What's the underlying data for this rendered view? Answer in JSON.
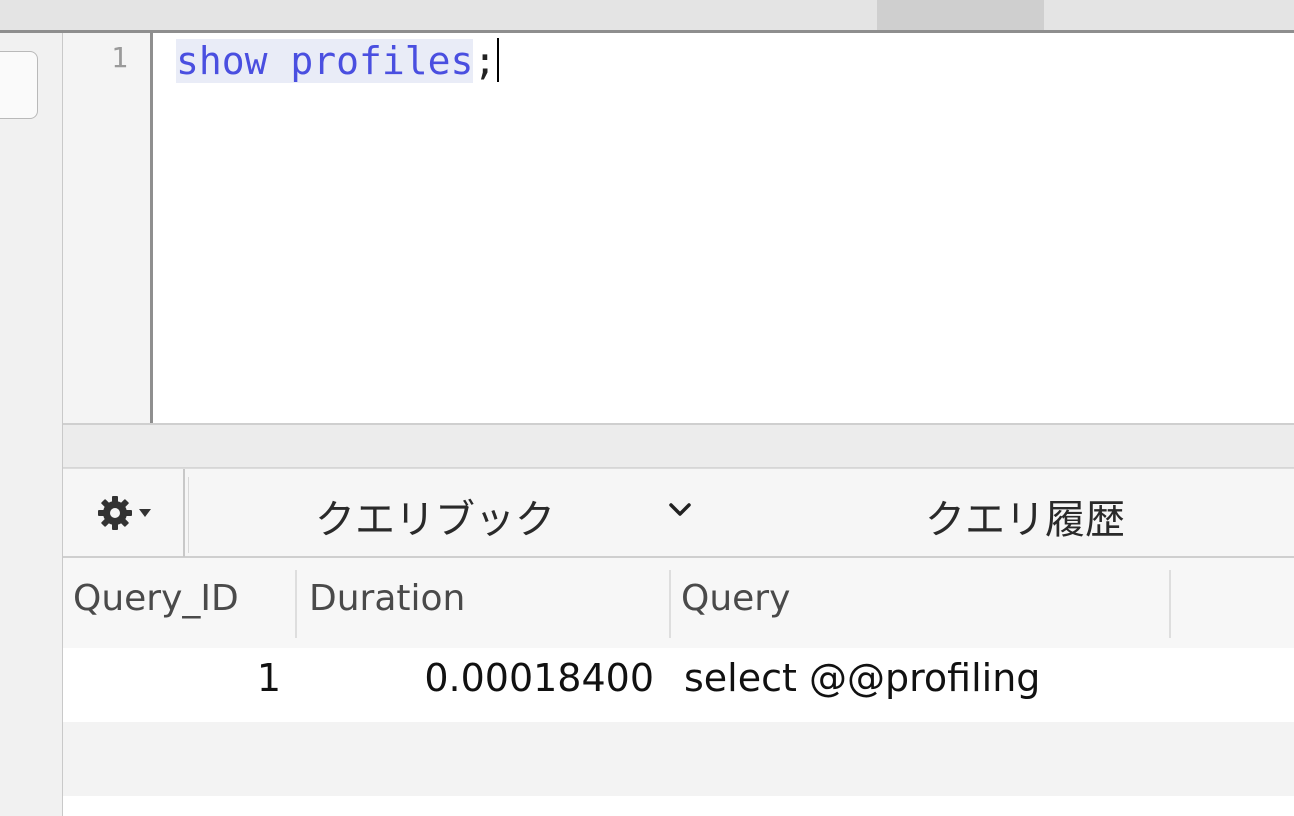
{
  "editor": {
    "line_number": "1",
    "code_keyword_1": "show",
    "code_space": " ",
    "code_keyword_2": "profiles",
    "code_terminator": ";"
  },
  "toolbar": {
    "gear_icon": "gear-icon",
    "query_book_label": "クエリブック",
    "query_history_label": "クエリ履歴"
  },
  "results": {
    "columns": [
      "Query_ID",
      "Duration",
      "Query"
    ],
    "rows": [
      {
        "query_id": "1",
        "duration": "0.00018400",
        "query": "select @@profiling"
      }
    ]
  },
  "colors": {
    "sql_keyword": "#4a4fe0",
    "selection_bg": "#e9ecf7",
    "toolbar_bg": "#f6f6f6",
    "alt_row_bg": "#f3f3f3"
  }
}
